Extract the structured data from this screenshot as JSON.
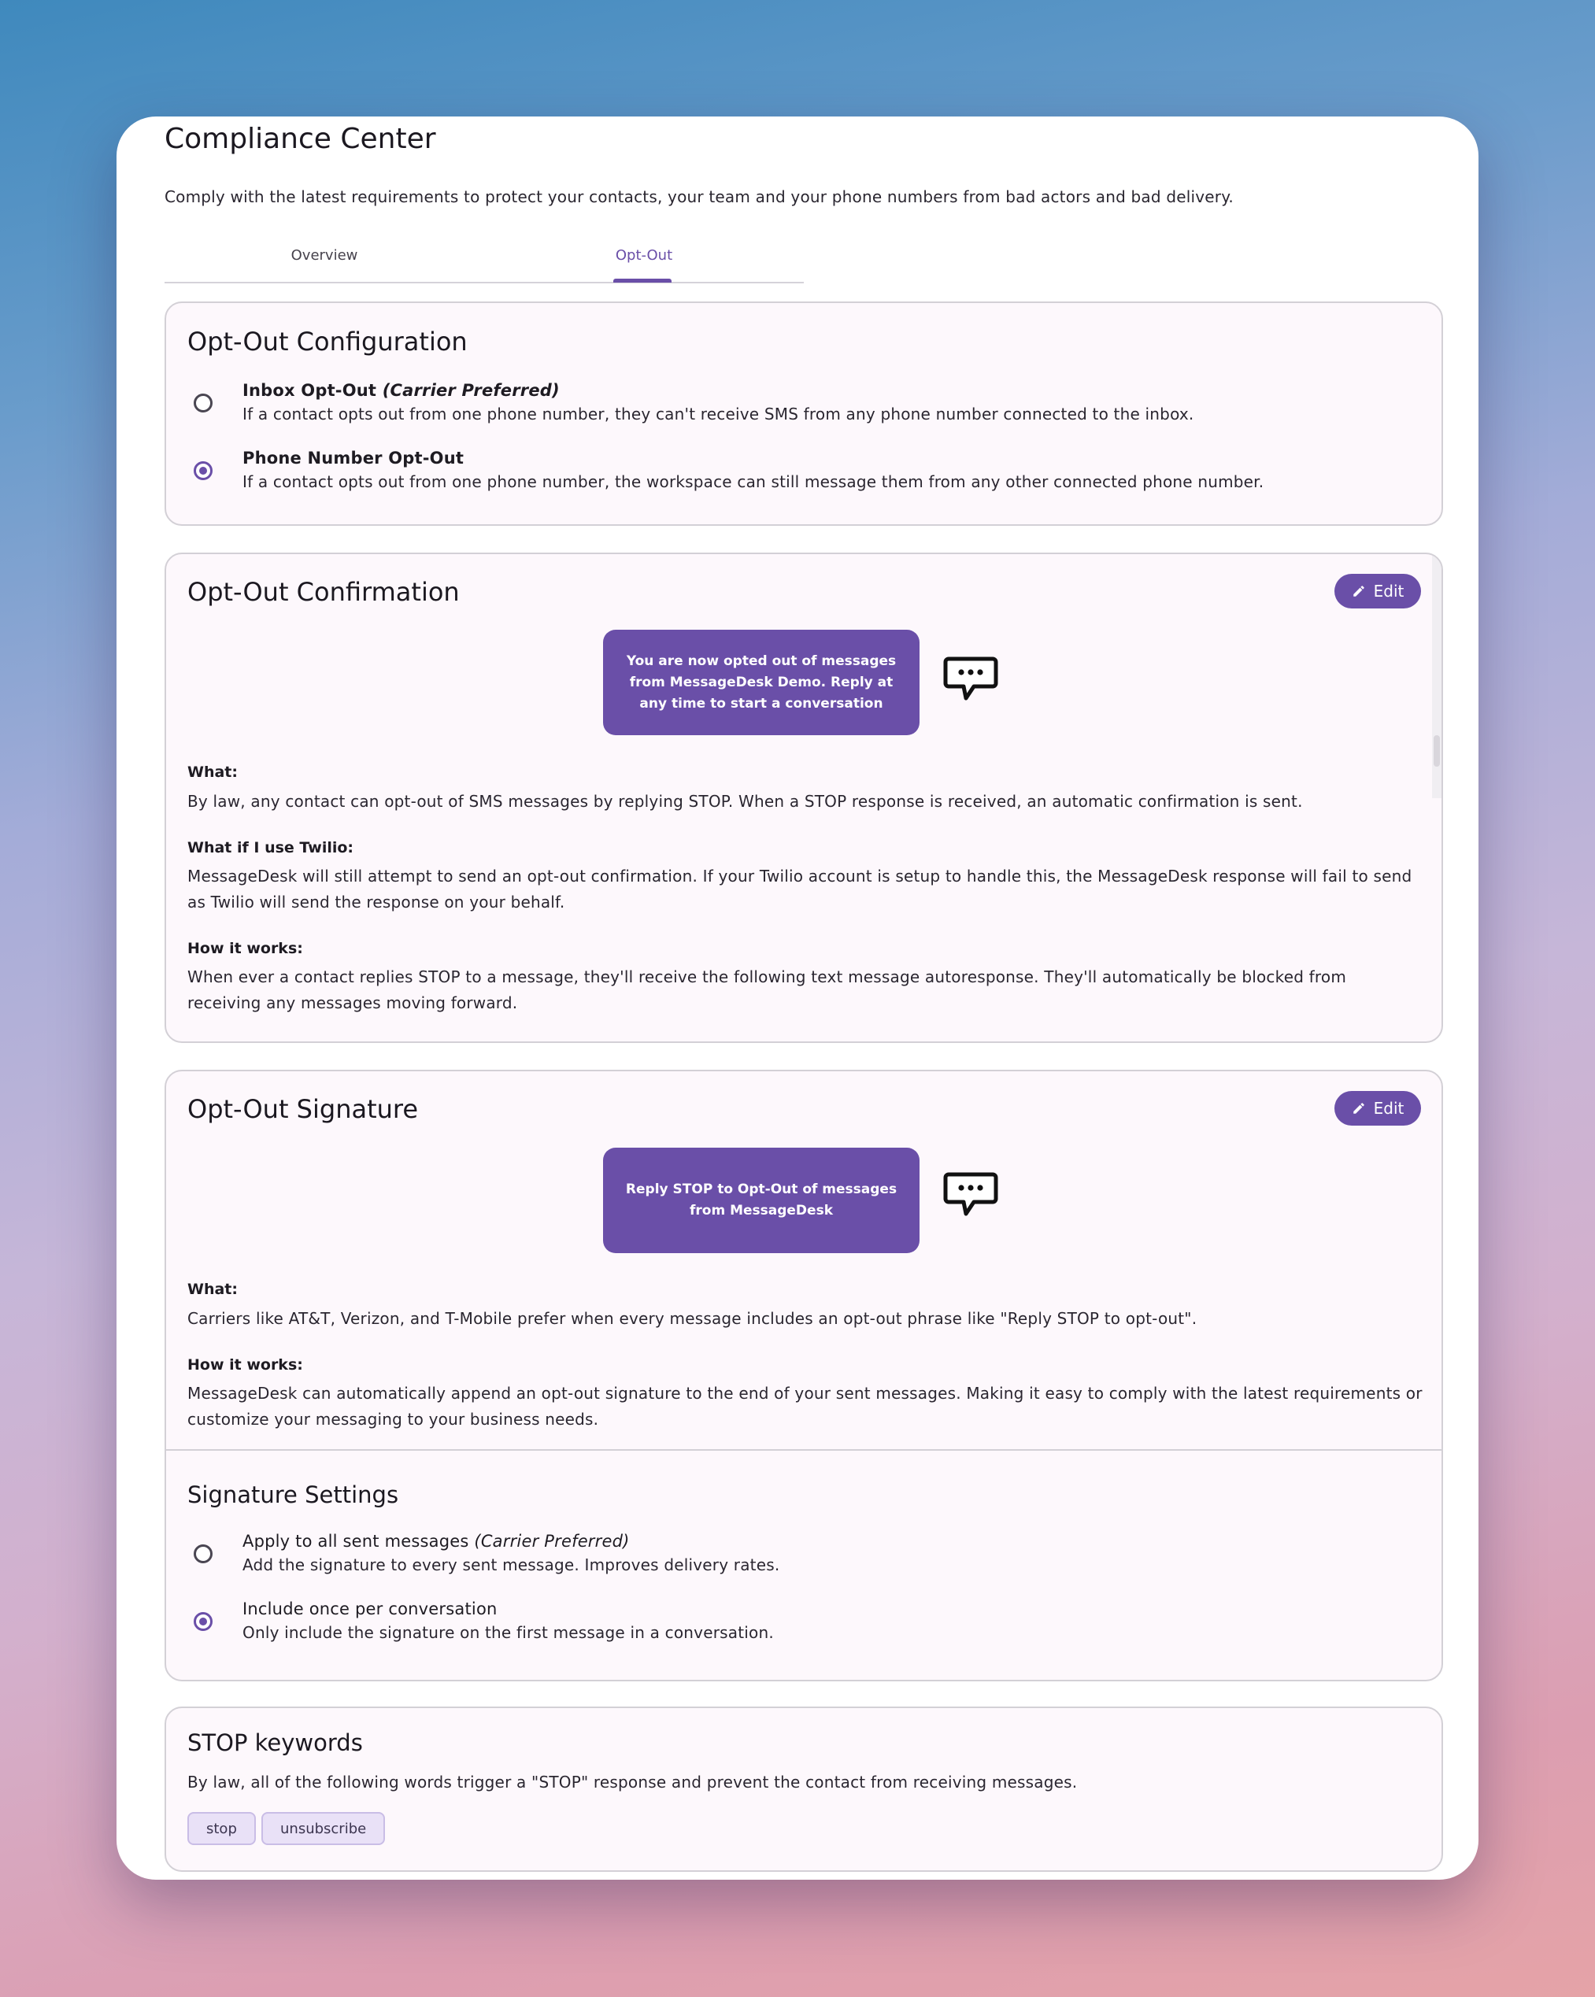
{
  "page": {
    "title": "Compliance Center",
    "subtitle": "Comply with the latest requirements to protect your contacts, your team and your phone numbers from bad actors and bad delivery."
  },
  "tabs": [
    {
      "label": "Overview",
      "active": false
    },
    {
      "label": "Opt-Out",
      "active": true
    }
  ],
  "opt_out_config": {
    "title": "Opt-Out Configuration",
    "options": [
      {
        "label": "Inbox Opt-Out",
        "label_em": "(Carrier Preferred)",
        "description": "If a contact opts out from one phone number, they can't receive SMS from any phone number connected to the inbox.",
        "selected": false
      },
      {
        "label": "Phone Number Opt-Out",
        "label_em": "",
        "description": "If a contact opts out from one phone number, the workspace can still message them from any other connected phone number.",
        "selected": true
      }
    ]
  },
  "opt_out_confirmation": {
    "title": "Opt-Out Confirmation",
    "edit_label": "Edit",
    "message": "You are now opted out of messages from MessageDesk Demo. Reply at any time to start a conversation",
    "what_label": "What:",
    "what_text": "By law, any contact can opt-out of SMS messages by replying STOP. When a STOP response is received, an automatic confirmation is sent.",
    "twilio_label": "What if I use Twilio:",
    "twilio_text": "MessageDesk will still attempt to send an opt-out confirmation. If your Twilio account is setup to handle this, the MessageDesk response will fail to send as Twilio will send the response on your behalf.",
    "how_label": "How it works:",
    "how_text": "When ever a contact replies STOP to a message, they'll receive the following text message autoresponse. They'll automatically be blocked from receiving any messages moving forward."
  },
  "opt_out_signature": {
    "title": "Opt-Out Signature",
    "edit_label": "Edit",
    "message": "Reply STOP to Opt-Out of messages from MessageDesk",
    "what_label": "What:",
    "what_text": "Carriers like AT&T, Verizon, and T-Mobile prefer when every message includes an opt-out phrase like \"Reply STOP to opt-out\".",
    "how_label": "How it works:",
    "how_text": "MessageDesk can automatically append an opt-out signature to the end of your sent messages. Making it easy to comply with the latest requirements or customize your messaging to your business needs.",
    "settings_title": "Signature Settings",
    "options": [
      {
        "label": "Apply to all sent messages",
        "label_em": "(Carrier Preferred)",
        "description": "Add the signature to every sent message. Improves delivery rates.",
        "selected": false
      },
      {
        "label": "Include once per conversation",
        "label_em": "",
        "description": "Only include the signature on the first message in a conversation.",
        "selected": true
      }
    ]
  },
  "stop_keywords": {
    "title": "STOP keywords",
    "description": "By law, all of the following words trigger a \"STOP\" response and prevent the contact from receiving messages.",
    "keywords": [
      "stop",
      "unsubscribe"
    ]
  },
  "icons": {
    "chat": "chat-bubble-icon",
    "edit": "pencil-icon"
  },
  "colors": {
    "accent": "#6a4fa8",
    "card_bg": "#fdf8fc",
    "chip_bg": "#e9e1f7"
  }
}
